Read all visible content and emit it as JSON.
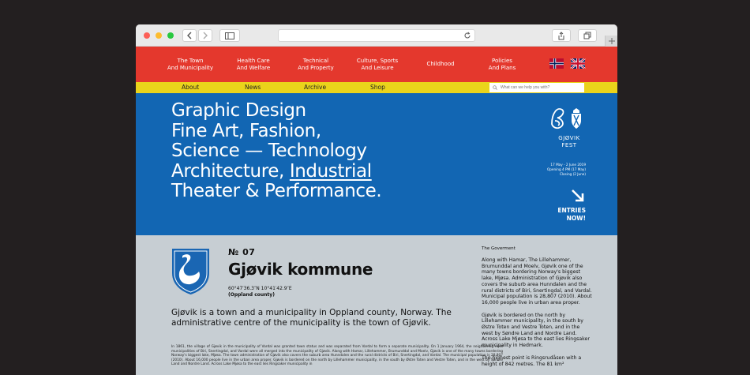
{
  "nav": {
    "items": [
      {
        "label": "The Town\nAnd Municipality"
      },
      {
        "label": "Health Care\nAnd Welfare"
      },
      {
        "label": "Technical\nAnd Property"
      },
      {
        "label": "Culture, Sports\nAnd Leisure"
      },
      {
        "label": "Childhood"
      },
      {
        "label": "Policies\nAnd Plans"
      }
    ]
  },
  "subnav": {
    "items": [
      {
        "label": "About"
      },
      {
        "label": "News"
      },
      {
        "label": "Archive"
      },
      {
        "label": "Shop"
      }
    ],
    "search_placeholder": "What can we help you with?"
  },
  "hero": {
    "lines": [
      "Graphic Design",
      "Fine Art, Fashion,",
      "Science — Technology",
      "Architecture, ",
      "Theater & Performance."
    ],
    "underlined": "Industrial"
  },
  "fest": {
    "name_line1": "GJØVIK",
    "name_line2": "FEST",
    "dates": "17 May - 2 June 2019",
    "opening": "Opening 4 PM (17 May)",
    "closing": "Closing (2 June)",
    "entries_line1": "ENTRIES",
    "entries_line2": "NOW!"
  },
  "municipality": {
    "number": "№ 07",
    "name": "Gjøvik kommune",
    "coords": "60°47′36.3″N 10°41′42.9″E",
    "county": "(Oppland county)",
    "lead": "Gjøvik is a town and a municipality in Oppland county, Norway. The administrative centre of the municipality is the town of Gjøvik.",
    "body": "In 1861, the village of Gjøvik in the municipality of Vardal was granted town status and was separated from Vardal to form a separate municipality. On 1 January 1964, the neighboring rural municipalities of Biri, Snertingdal, and Vardal were all merged into the municipality of Gjøvik. Along with Hamar, Lillehammer, Brumunddal and Moelv, Gjøvik is one of the many towns bordering Norway's biggest lake, Mjøsa. The town administration of Gjøvik also covers the suburb area Hunndalen and the rural districts of Biri, Snertingdal, and Vardal. The municipal population is 28,807 (2010). About 16,000 people live in the urban area proper. Gjøvik is bordered on the north by Lillehammer municipality, in the south by Østre Toten and Vestre Toten, and in the west by Søndre Land and Nordre Land. Across Lake Mjøsa to the east lies Ringsaker municipality in"
  },
  "side": {
    "heading": "The Goverment",
    "p1": "Along with Hamar, The Lillehammer, Brumunddal and Moelv, Gjøvik one of the many towns bordering Norway's biggest lake, Mjøsa. Administration of Gjøvik also covers the suburb area Hunndalen and the rural districts of Biri, Snertingdal, and Vardal. Municipal population is 28,807 (2010). About 16,000 people live in urban area proper.",
    "p2": "Gjøvik is bordered on the north by Lillehammer municipality, in the south by Østre Toten and Vestre Toten, and in the west by Søndre Land and Nordre Land. Across Lake Mjøsa to the east lies Ringsaker municipality in Hedmark.",
    "p3": "The highest point is Ringsrudåsen with a height of 842 metres. The 81 km²"
  },
  "colors": {
    "nav_red": "#e4382d",
    "subnav_yellow": "#ead31b",
    "hero_blue": "#1266b3",
    "content_grey": "#c7ced3"
  },
  "icons": [
    "back-icon",
    "forward-icon",
    "sidebar-icon",
    "reload-icon",
    "share-icon",
    "tabs-icon",
    "plus-icon",
    "norway-flag-icon",
    "uk-flag-icon",
    "search-icon",
    "gjovik-fest-logo-icon",
    "arrow-down-right-icon",
    "swan-crest-icon"
  ]
}
